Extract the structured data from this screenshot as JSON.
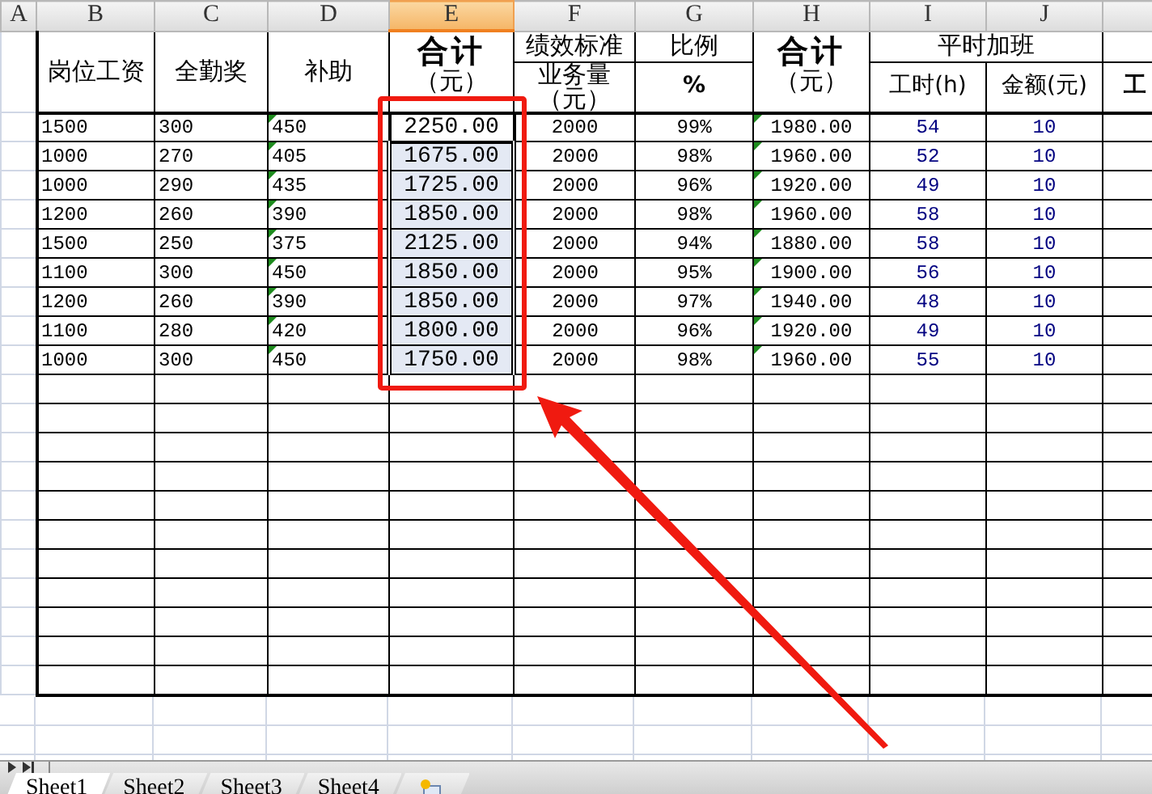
{
  "column_headers": [
    {
      "label": "A",
      "selected": false
    },
    {
      "label": "B",
      "selected": false
    },
    {
      "label": "C",
      "selected": false
    },
    {
      "label": "D",
      "selected": false
    },
    {
      "label": "E",
      "selected": true
    },
    {
      "label": "F",
      "selected": false
    },
    {
      "label": "G",
      "selected": false
    },
    {
      "label": "H",
      "selected": false
    },
    {
      "label": "I",
      "selected": false
    },
    {
      "label": "J",
      "selected": false
    }
  ],
  "header_cells": [
    {
      "kind": "tall",
      "label": "岗位工资"
    },
    {
      "kind": "tall",
      "label": "全勤奖"
    },
    {
      "kind": "tall",
      "label": "补助"
    },
    {
      "kind": "total",
      "title": "合计",
      "unit": "（元）"
    },
    {
      "kind": "group",
      "title": "绩效标准",
      "subs": [
        {
          "label": "业务量",
          "unit": "（元）"
        }
      ]
    },
    {
      "kind": "group",
      "title": "比例",
      "subs": [
        {
          "label": "%"
        }
      ]
    },
    {
      "kind": "total",
      "title": "合计",
      "unit": "（元）"
    },
    {
      "kind": "group",
      "title": "平时加班",
      "subs": [
        {
          "label": "工时(h)"
        },
        {
          "label": "金额(元)"
        }
      ]
    },
    {
      "kind": "group",
      "subs": [
        {
          "label": "工"
        }
      ]
    }
  ],
  "columns": [
    {
      "kind": "left",
      "marked": false
    },
    {
      "kind": "left",
      "marked": false
    },
    {
      "kind": "left",
      "marked": true
    },
    {
      "kind": "large",
      "marked": false
    },
    {
      "kind": "center",
      "marked": false
    },
    {
      "kind": "center",
      "marked": false
    },
    {
      "kind": "center",
      "marked": true
    },
    {
      "kind": "blue",
      "marked": false
    },
    {
      "kind": "blue",
      "marked": false
    }
  ],
  "rows": [
    {
      "active": true,
      "cells": [
        "1500",
        "300",
        "450",
        "2250.00",
        "2000",
        "99%",
        "1980.00",
        "54",
        "10"
      ]
    },
    {
      "active": false,
      "cells": [
        "1000",
        "270",
        "405",
        "1675.00",
        "2000",
        "98%",
        "1960.00",
        "52",
        "10"
      ]
    },
    {
      "active": false,
      "cells": [
        "1000",
        "290",
        "435",
        "1725.00",
        "2000",
        "96%",
        "1920.00",
        "49",
        "10"
      ]
    },
    {
      "active": false,
      "cells": [
        "1200",
        "260",
        "390",
        "1850.00",
        "2000",
        "98%",
        "1960.00",
        "58",
        "10"
      ]
    },
    {
      "active": false,
      "cells": [
        "1500",
        "250",
        "375",
        "2125.00",
        "2000",
        "94%",
        "1880.00",
        "58",
        "10"
      ]
    },
    {
      "active": false,
      "cells": [
        "1100",
        "300",
        "450",
        "1850.00",
        "2000",
        "95%",
        "1900.00",
        "56",
        "10"
      ]
    },
    {
      "active": false,
      "cells": [
        "1200",
        "260",
        "390",
        "1850.00",
        "2000",
        "97%",
        "1940.00",
        "48",
        "10"
      ]
    },
    {
      "active": false,
      "cells": [
        "1100",
        "280",
        "420",
        "1800.00",
        "2000",
        "96%",
        "1920.00",
        "49",
        "10"
      ]
    },
    {
      "active": false,
      "cells": [
        "1000",
        "300",
        "450",
        "1750.00",
        "2000",
        "98%",
        "1960.00",
        "55",
        "10"
      ]
    }
  ],
  "sheet_tabs": [
    {
      "label": "Sheet1",
      "selected": true
    },
    {
      "label": "Sheet2",
      "selected": false
    },
    {
      "label": "Sheet3",
      "selected": false
    },
    {
      "label": "Sheet4",
      "selected": false
    }
  ]
}
